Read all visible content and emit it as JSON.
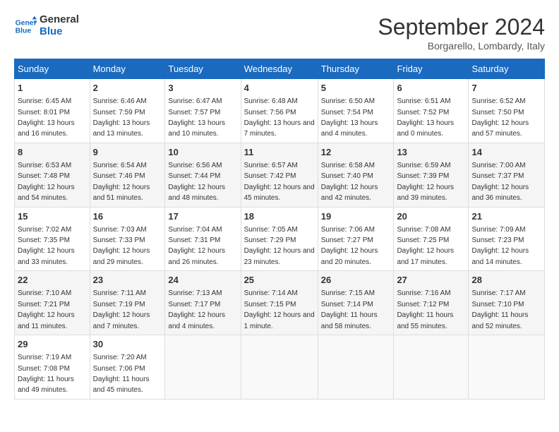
{
  "logo": {
    "line1": "General",
    "line2": "Blue"
  },
  "title": "September 2024",
  "subtitle": "Borgarello, Lombardy, Italy",
  "days_of_week": [
    "Sunday",
    "Monday",
    "Tuesday",
    "Wednesday",
    "Thursday",
    "Friday",
    "Saturday"
  ],
  "weeks": [
    [
      {
        "day": "1",
        "sunrise": "6:45 AM",
        "sunset": "8:01 PM",
        "daylight": "13 hours and 16 minutes."
      },
      {
        "day": "2",
        "sunrise": "6:46 AM",
        "sunset": "7:59 PM",
        "daylight": "13 hours and 13 minutes."
      },
      {
        "day": "3",
        "sunrise": "6:47 AM",
        "sunset": "7:57 PM",
        "daylight": "13 hours and 10 minutes."
      },
      {
        "day": "4",
        "sunrise": "6:48 AM",
        "sunset": "7:56 PM",
        "daylight": "13 hours and 7 minutes."
      },
      {
        "day": "5",
        "sunrise": "6:50 AM",
        "sunset": "7:54 PM",
        "daylight": "13 hours and 4 minutes."
      },
      {
        "day": "6",
        "sunrise": "6:51 AM",
        "sunset": "7:52 PM",
        "daylight": "13 hours and 0 minutes."
      },
      {
        "day": "7",
        "sunrise": "6:52 AM",
        "sunset": "7:50 PM",
        "daylight": "12 hours and 57 minutes."
      }
    ],
    [
      {
        "day": "8",
        "sunrise": "6:53 AM",
        "sunset": "7:48 PM",
        "daylight": "12 hours and 54 minutes."
      },
      {
        "day": "9",
        "sunrise": "6:54 AM",
        "sunset": "7:46 PM",
        "daylight": "12 hours and 51 minutes."
      },
      {
        "day": "10",
        "sunrise": "6:56 AM",
        "sunset": "7:44 PM",
        "daylight": "12 hours and 48 minutes."
      },
      {
        "day": "11",
        "sunrise": "6:57 AM",
        "sunset": "7:42 PM",
        "daylight": "12 hours and 45 minutes."
      },
      {
        "day": "12",
        "sunrise": "6:58 AM",
        "sunset": "7:40 PM",
        "daylight": "12 hours and 42 minutes."
      },
      {
        "day": "13",
        "sunrise": "6:59 AM",
        "sunset": "7:39 PM",
        "daylight": "12 hours and 39 minutes."
      },
      {
        "day": "14",
        "sunrise": "7:00 AM",
        "sunset": "7:37 PM",
        "daylight": "12 hours and 36 minutes."
      }
    ],
    [
      {
        "day": "15",
        "sunrise": "7:02 AM",
        "sunset": "7:35 PM",
        "daylight": "12 hours and 33 minutes."
      },
      {
        "day": "16",
        "sunrise": "7:03 AM",
        "sunset": "7:33 PM",
        "daylight": "12 hours and 29 minutes."
      },
      {
        "day": "17",
        "sunrise": "7:04 AM",
        "sunset": "7:31 PM",
        "daylight": "12 hours and 26 minutes."
      },
      {
        "day": "18",
        "sunrise": "7:05 AM",
        "sunset": "7:29 PM",
        "daylight": "12 hours and 23 minutes."
      },
      {
        "day": "19",
        "sunrise": "7:06 AM",
        "sunset": "7:27 PM",
        "daylight": "12 hours and 20 minutes."
      },
      {
        "day": "20",
        "sunrise": "7:08 AM",
        "sunset": "7:25 PM",
        "daylight": "12 hours and 17 minutes."
      },
      {
        "day": "21",
        "sunrise": "7:09 AM",
        "sunset": "7:23 PM",
        "daylight": "12 hours and 14 minutes."
      }
    ],
    [
      {
        "day": "22",
        "sunrise": "7:10 AM",
        "sunset": "7:21 PM",
        "daylight": "12 hours and 11 minutes."
      },
      {
        "day": "23",
        "sunrise": "7:11 AM",
        "sunset": "7:19 PM",
        "daylight": "12 hours and 7 minutes."
      },
      {
        "day": "24",
        "sunrise": "7:13 AM",
        "sunset": "7:17 PM",
        "daylight": "12 hours and 4 minutes."
      },
      {
        "day": "25",
        "sunrise": "7:14 AM",
        "sunset": "7:15 PM",
        "daylight": "12 hours and 1 minute."
      },
      {
        "day": "26",
        "sunrise": "7:15 AM",
        "sunset": "7:14 PM",
        "daylight": "11 hours and 58 minutes."
      },
      {
        "day": "27",
        "sunrise": "7:16 AM",
        "sunset": "7:12 PM",
        "daylight": "11 hours and 55 minutes."
      },
      {
        "day": "28",
        "sunrise": "7:17 AM",
        "sunset": "7:10 PM",
        "daylight": "11 hours and 52 minutes."
      }
    ],
    [
      {
        "day": "29",
        "sunrise": "7:19 AM",
        "sunset": "7:08 PM",
        "daylight": "11 hours and 49 minutes."
      },
      {
        "day": "30",
        "sunrise": "7:20 AM",
        "sunset": "7:06 PM",
        "daylight": "11 hours and 45 minutes."
      },
      null,
      null,
      null,
      null,
      null
    ]
  ]
}
